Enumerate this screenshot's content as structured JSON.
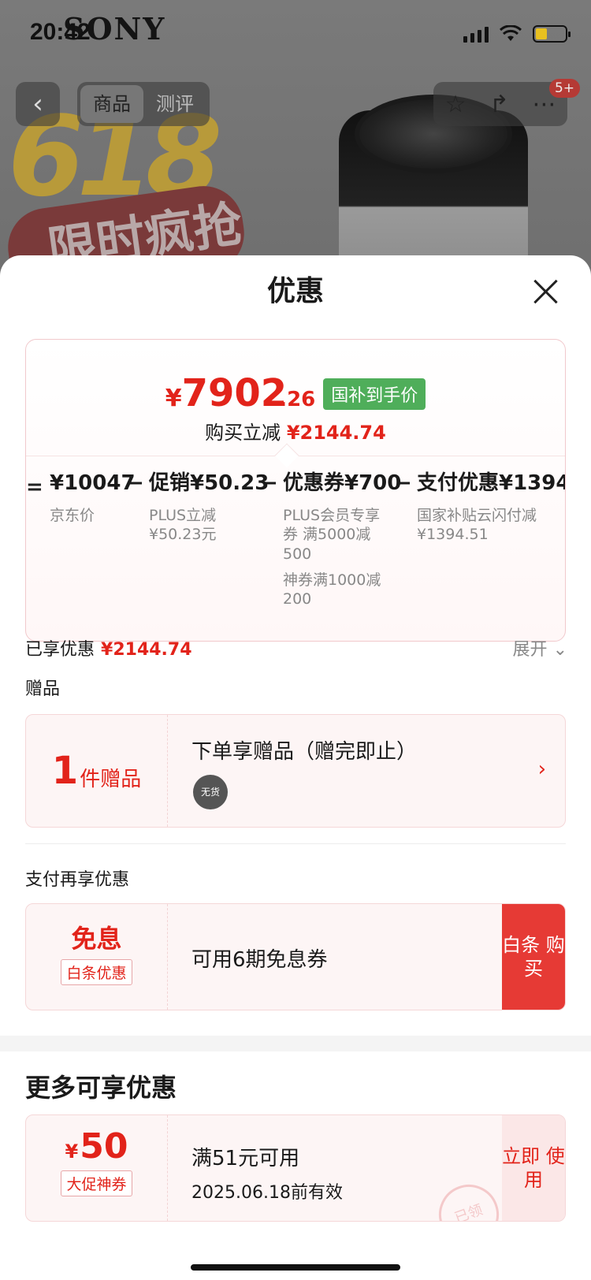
{
  "status_bar": {
    "time": "20:42",
    "brand": "SONY"
  },
  "header": {
    "tabs": [
      "商品",
      "测评"
    ],
    "badge": "5+"
  },
  "background_promo": {
    "number": "618",
    "text": "限时疯抢"
  },
  "sheet": {
    "title": "优惠",
    "final_price": {
      "currency": "¥",
      "integer": "7902",
      "decimal": ".26",
      "tag": "国补到手价"
    },
    "instant_reduction": {
      "label": "购买立减",
      "value": "¥2144.74"
    },
    "formula": {
      "equals": "=",
      "items": [
        {
          "head": "¥10047",
          "subs": [
            "京东价"
          ]
        },
        {
          "op": "−",
          "head": "促销¥50.23",
          "subs": [
            "PLUS立减 ¥50.23元"
          ]
        },
        {
          "op": "−",
          "head": "优惠券¥700",
          "subs": [
            "PLUS会员专享券 满5000减500",
            "神券满1000减200"
          ]
        },
        {
          "op": "−",
          "head": "支付优惠¥1394",
          "subs": [
            "国家补贴云闪付减 ¥1394.51"
          ]
        }
      ]
    },
    "enjoyed": {
      "label": "已享优惠",
      "value": "¥2144.74",
      "expand": "展开"
    },
    "gift_section": {
      "label": "赠品",
      "count": "1",
      "unit": "件赠品",
      "title": "下单享赠品（赠完即止）",
      "thumb_status": "无货"
    },
    "pay_section": {
      "label": "支付再享优惠",
      "big": "免息",
      "tag": "白条优惠",
      "text": "可用6期免息券",
      "button": "白条 购买"
    },
    "more_section": {
      "title": "更多可享优惠",
      "coupon": {
        "currency": "¥",
        "amount": "50",
        "tag": "大促神券",
        "condition": "满51元可用",
        "expiry": "2025.06.18前有效",
        "button": "立即 使用",
        "stamp": "已领"
      }
    }
  },
  "colors": {
    "accent": "#e2231a",
    "green_tag": "#4fae5a",
    "pay_button": "#e63a35"
  }
}
